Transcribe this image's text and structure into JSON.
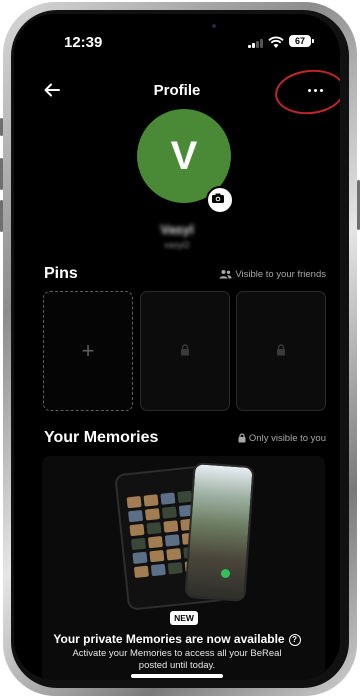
{
  "status_bar": {
    "time": "12:39",
    "battery": "67"
  },
  "header": {
    "title": "Profile"
  },
  "profile": {
    "avatar_initial": "V",
    "username": "Vasyl",
    "handle": "vasyl2"
  },
  "pins": {
    "title": "Pins",
    "visibility_note": "Visible to your friends"
  },
  "memories": {
    "title": "Your Memories",
    "visibility_note": "Only visible to you",
    "badge": "NEW",
    "promo_title": "Your private Memories are now available",
    "promo_description": "Activate your Memories to access all your BeReal posted until today."
  },
  "colors": {
    "background": "#000000",
    "avatar": "#4a8a36",
    "annotation": "#c0262b"
  }
}
